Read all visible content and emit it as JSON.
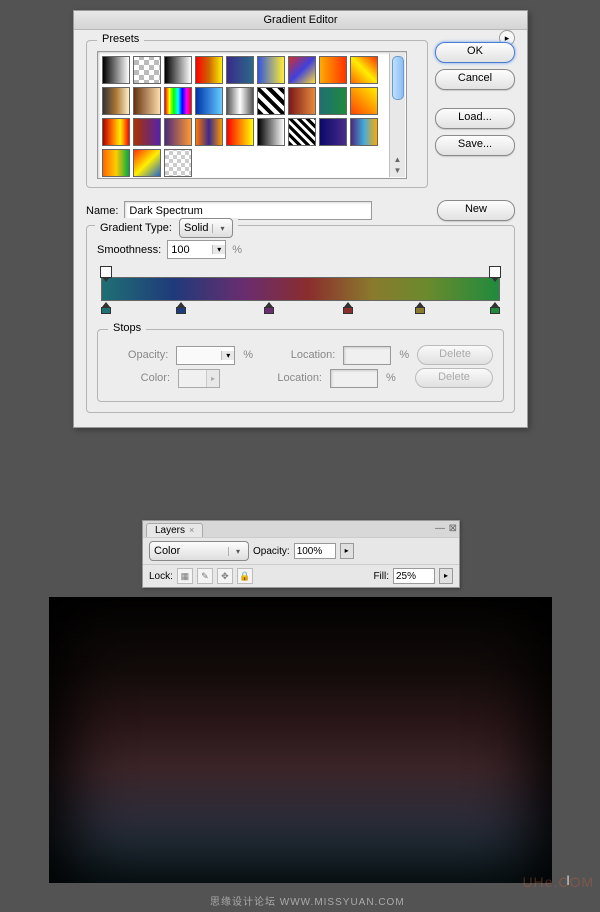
{
  "dialog": {
    "title": "Gradient Editor",
    "presets_label": "Presets",
    "swatches": [
      "linear-gradient(90deg,#000,#fff)",
      "repeating-conic-gradient(#bbb 0 25%,#fff 0 50%) 0/10px 10px",
      "linear-gradient(90deg,#000,#fff)",
      "linear-gradient(90deg,#ff0000,#cc6600,#ffee00)",
      "linear-gradient(90deg,#3a2a8a,#2a6a8a)",
      "linear-gradient(90deg,#3355dd,#ffee33)",
      "linear-gradient(135deg,#cc3030,#4040dd,#ffdd30)",
      "linear-gradient(90deg,#ffaa00,#ff3300)",
      "linear-gradient(45deg,#ff6600,#ffee00,#ff3300)",
      "linear-gradient(90deg,#333,#aa7733,#ffeecc)",
      "linear-gradient(90deg,#663311,#ffddaa)",
      "linear-gradient(90deg,#ff0000,#ffff00,#00ff00,#00ffff,#0000ff,#ff00ff,#ff0000)",
      "linear-gradient(90deg,#0033aa,#66ccff)",
      "linear-gradient(90deg,#555,#fff,#555)",
      "repeating-linear-gradient(45deg,#000 0 4px,#fff 4px 8px)",
      "linear-gradient(90deg,#7a1818,#e68a3a)",
      "linear-gradient(90deg,#1f6f74,#1f8a3d)",
      "linear-gradient(45deg,#ff4400,#ffee00)",
      "linear-gradient(90deg,#aa0000,#ff6600,#ffee00,#ff0000)",
      "linear-gradient(90deg,#aa3300,#5522aa)",
      "linear-gradient(90deg,#4a2a7a,#ff9933)",
      "linear-gradient(90deg,#ff7700,#3a2a8a,#ff9900)",
      "linear-gradient(90deg,#ff0000,#ffff00)",
      "linear-gradient(90deg,#000,#fff)",
      "repeating-linear-gradient(45deg,#000 0 3px,#fff 3px 6px)",
      "linear-gradient(90deg,#0a0a6a,#4a2a8a)",
      "linear-gradient(90deg,#4a2a7a,#44aadd,#ffaa00)",
      "linear-gradient(90deg,#ff6600,#ffcc00,#00aa44)",
      "linear-gradient(135deg,#ff3300,#ffee00,#2266cc)",
      "repeating-conic-gradient(#ccc 0 25%,#fff 0 50%) 0/8px 8px"
    ],
    "name_label": "Name:",
    "name_value": "Dark Spectrum",
    "buttons": {
      "ok": "OK",
      "cancel": "Cancel",
      "load": "Load...",
      "save": "Save...",
      "new": "New"
    },
    "gradient_type_label": "Gradient Type:",
    "gradient_type_value": "Solid",
    "smoothness_label": "Smoothness:",
    "smoothness_value": "100",
    "percent": "%",
    "stops_label": "Stops",
    "opacity_label": "Opacity:",
    "color_label": "Color:",
    "location_label": "Location:",
    "delete_label": "Delete",
    "color_stops": [
      {
        "pos": 1,
        "color": "#1f6f74"
      },
      {
        "pos": 20,
        "color": "#1f3a7a"
      },
      {
        "pos": 42,
        "color": "#6a2d6f"
      },
      {
        "pos": 62,
        "color": "#8a2d2d"
      },
      {
        "pos": 80,
        "color": "#8a7a2d"
      },
      {
        "pos": 99,
        "color": "#1f8a3d"
      }
    ]
  },
  "layers": {
    "tab": "Layers",
    "blend_mode": "Color",
    "opacity_label": "Opacity:",
    "opacity_value": "100%",
    "lock_label": "Lock:",
    "fill_label": "Fill:",
    "fill_value": "25%"
  },
  "watermark": "思缘设计论坛  WWW.MISSYUAN.COM",
  "watermark2": "UHe.COM"
}
